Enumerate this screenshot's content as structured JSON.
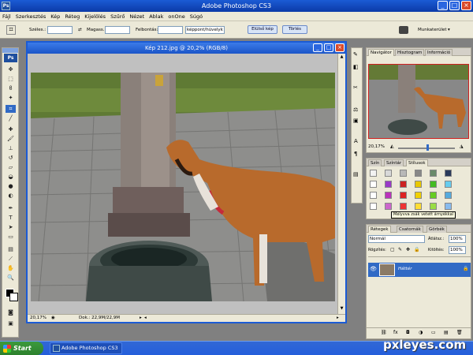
{
  "app": {
    "title": "Adobe Photoshop CS3",
    "logo": "Ps"
  },
  "menu": [
    "Fájl",
    "Szerkesztés",
    "Kép",
    "Réteg",
    "Kijelölés",
    "Szűrő",
    "Nézet",
    "Ablak",
    "onOne",
    "Súgó"
  ],
  "options": {
    "width_label": "Széles.:",
    "height_label": "Magass.:",
    "resolution_label": "Felbontás:",
    "unit_value": "képpont/hüvelyk",
    "front_image_button": "Elülső kép",
    "clear_button": "Törlés",
    "workspace_label": "Munkaterület"
  },
  "document": {
    "title": "Kép 212.jpg @ 20,2% (RGB/8)",
    "zoom": "20,17%",
    "doc_size": "Dok.: 22,9M/22,9M"
  },
  "navigator": {
    "tabs": [
      "Navigátor",
      "Hisztogram",
      "Információ"
    ],
    "zoom": "20,17%"
  },
  "styles": {
    "tabs": [
      "Szín",
      "Színtár",
      "Stílusok"
    ],
    "tooltip": "Mélyvva zsák vetett árnyékkal",
    "swatch_colors": [
      "#f2f2f2",
      "#d8d8d8",
      "#b8b8b8",
      "#888888",
      "#6a8a6a",
      "#2a3a5a",
      "#ffffff",
      "#9a3ac8",
      "#cc2222",
      "#e8c800",
      "#44bb22",
      "#66ccee",
      "#ffffff",
      "#bb33bb",
      "#dd2222",
      "#f0d000",
      "#66cc22",
      "#55aadd",
      "#ffffff",
      "#cc66cc",
      "#ee3333",
      "#ffdd33",
      "#99dd44",
      "#88bbee"
    ]
  },
  "layers": {
    "tabs": [
      "Rétegek",
      "Csatornák",
      "Görbék"
    ],
    "blend_mode": "Normál",
    "opacity_label": "Átlátsz.:",
    "opacity_value": "100%",
    "lock_label": "Rögzítés:",
    "fill_label": "Kitöltés:",
    "fill_value": "100%",
    "layer_name": "Háttér"
  },
  "taskbar": {
    "start": "Start",
    "item": "Adobe Photoshop CS3"
  },
  "watermark": "pxleyes.com"
}
